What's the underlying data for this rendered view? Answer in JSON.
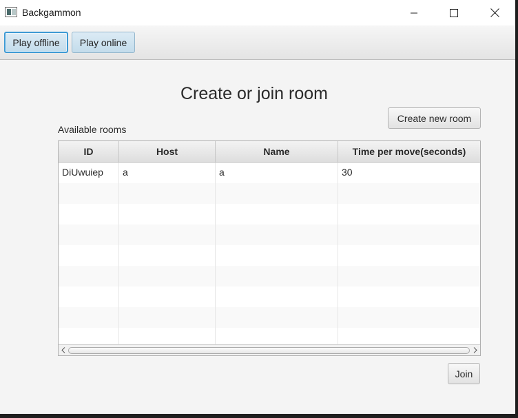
{
  "window": {
    "title": "Backgammon",
    "controls": {
      "minimize": "minimize-icon",
      "maximize": "maximize-icon",
      "close": "close-icon"
    }
  },
  "toolbar": {
    "play_offline_label": "Play offline",
    "play_online_label": "Play online"
  },
  "main": {
    "title": "Create or join room",
    "create_room_label": "Create new room",
    "rooms_label": "Available rooms",
    "join_label": "Join"
  },
  "table": {
    "columns": [
      "ID",
      "Host",
      "Name",
      "Time per move(seconds)"
    ],
    "rows": [
      [
        "DiUwuiep",
        "a",
        "a",
        "30"
      ],
      [
        "",
        "",
        "",
        ""
      ],
      [
        "",
        "",
        "",
        ""
      ],
      [
        "",
        "",
        "",
        ""
      ],
      [
        "",
        "",
        "",
        ""
      ],
      [
        "",
        "",
        "",
        ""
      ],
      [
        "",
        "",
        "",
        ""
      ],
      [
        "",
        "",
        "",
        ""
      ],
      [
        "",
        "",
        "",
        ""
      ]
    ]
  },
  "colors": {
    "accent_focus": "#3d9ad4",
    "toolbar_button": "#c3dceb",
    "background": "#f4f4f4"
  }
}
